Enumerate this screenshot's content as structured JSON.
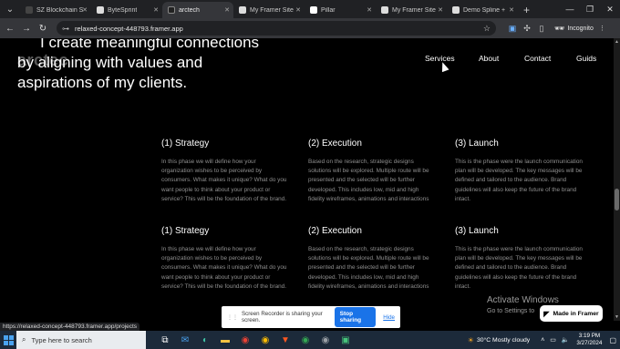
{
  "browser": {
    "tabs": [
      {
        "title": "SZ Blockchain S",
        "favicon_color": "#444444"
      },
      {
        "title": "ByteSprint",
        "favicon_color": "#dddddd"
      },
      {
        "title": "arctech",
        "favicon_color": "#222222",
        "active": true
      },
      {
        "title": "My Framer Site",
        "favicon_color": "#dddddd"
      },
      {
        "title": "Pillar",
        "favicon_color": "#ffffff"
      },
      {
        "title": "My Framer Site",
        "favicon_color": "#dddddd"
      },
      {
        "title": "Demo Spline +",
        "favicon_color": "#dddddd"
      }
    ],
    "url": "relaxed-concept-448793.framer.app",
    "incognito_label": "Incognito"
  },
  "site": {
    "hero_line1": "I create meaningful connections",
    "hero_line2": "by aligning with values and",
    "hero_line3": "aspirations of my clients.",
    "logo": "arctec",
    "nav": [
      "Services",
      "About",
      "Contact",
      "Guids"
    ],
    "sections": [
      [
        {
          "title": "(1) Strategy",
          "body": "In this phase we will define how your organization wishes to be perceived by consumers. What makes it unique? What do you want people to think about your product or service? This will be the foundation of the brand."
        },
        {
          "title": "(2) Execution",
          "body": "Based on the research, strategic designs solutions will be explored. Multiple route will be presented and the selected will be further developed. This includes low, mid and high fidelity wireframes, animations and interactions"
        },
        {
          "title": "(3) Launch",
          "body": "This is the phase were the launch communication plan will be developed. The key messages will be defined and tailored to the audience. Brand guidelines will also keep the future of the brand intact."
        }
      ],
      [
        {
          "title": "(1) Strategy",
          "body": "In this phase we will define how your organization wishes to be perceived by consumers. What makes it unique? What do you want people to think about your product or service? This will be the foundation of the brand."
        },
        {
          "title": "(2) Execution",
          "body": "Based on the research, strategic designs solutions will be explored. Multiple route will be presented and the selected will be further developed. This includes low, mid and high fidelity wireframes, animations and interactions"
        },
        {
          "title": "(3) Launch",
          "body": "This is the phase were the launch communication plan will be developed. The key messages will be defined and tailored to the audience. Brand guidelines will also keep the future of the brand intact."
        }
      ]
    ],
    "framer_badge": "Made in Framer"
  },
  "status_url": "https://relaxed-concept-448793.framer.app/projects",
  "screen_share": {
    "message": "Screen Recorder is sharing your screen.",
    "stop_label": "Stop sharing",
    "hide_label": "Hide"
  },
  "activate_windows": {
    "title": "Activate Windows",
    "subtitle": "Go to Settings to"
  },
  "taskbar": {
    "search_placeholder": "Type here to search",
    "weather": "30°C  Mostly cloudy",
    "time": "3:19 PM",
    "date": "3/27/2024"
  }
}
